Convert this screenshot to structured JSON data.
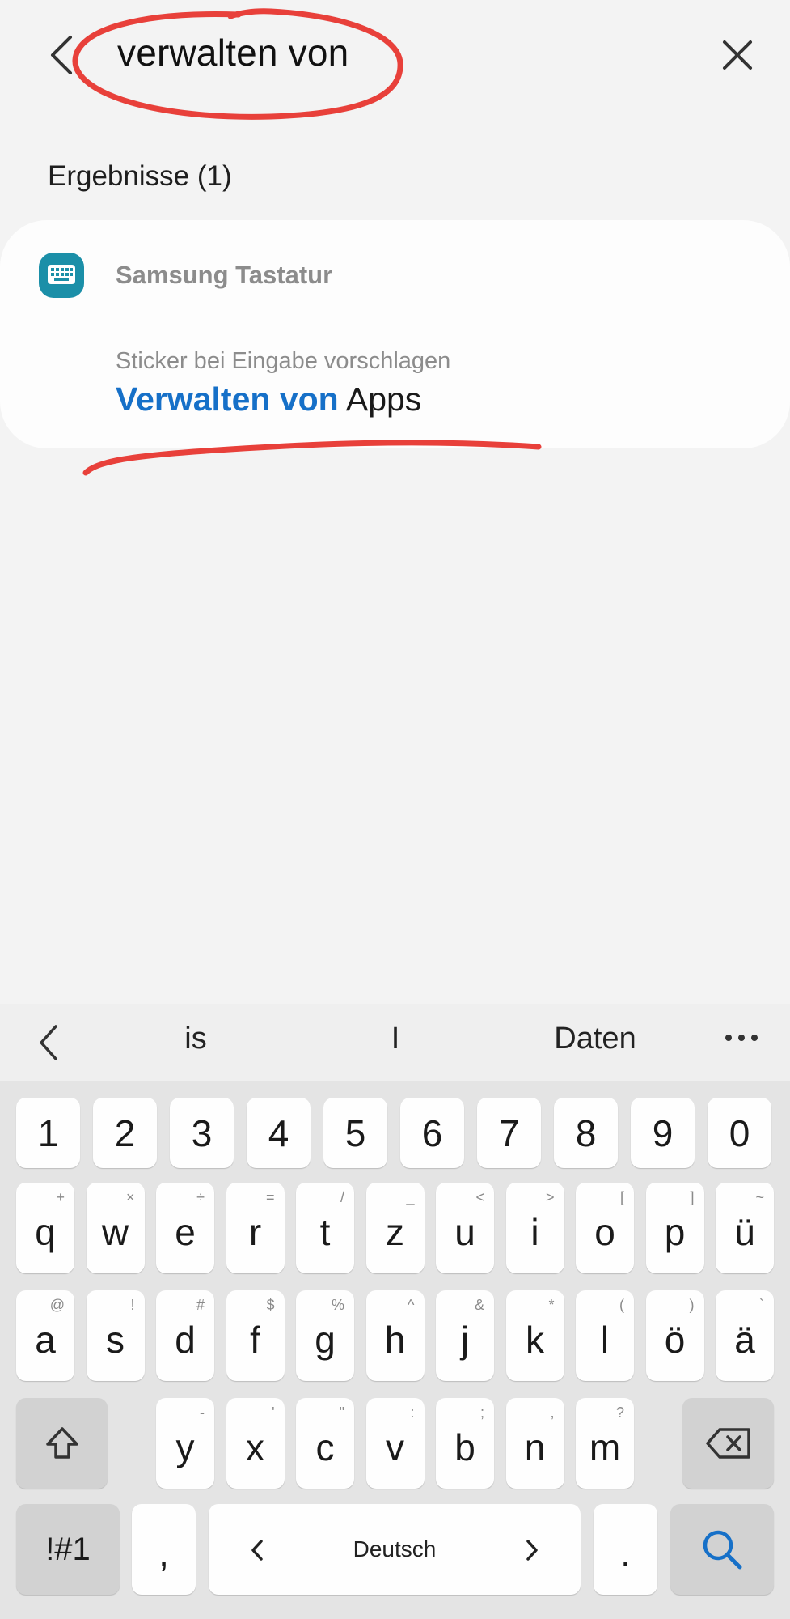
{
  "search": {
    "query": "verwalten von"
  },
  "results": {
    "header": "Ergebnisse (1)",
    "items": [
      {
        "app": "Samsung Tastatur",
        "subtitle": "Sticker bei Eingabe vorschlagen",
        "title_highlight": "Verwalten von",
        "title_rest": " Apps",
        "icon": "keyboard-icon"
      }
    ]
  },
  "keyboard": {
    "suggestions": [
      "is",
      "I",
      "Daten"
    ],
    "number_row": [
      "1",
      "2",
      "3",
      "4",
      "5",
      "6",
      "7",
      "8",
      "9",
      "0"
    ],
    "row1": [
      {
        "main": "q",
        "sec": "+"
      },
      {
        "main": "w",
        "sec": "×"
      },
      {
        "main": "e",
        "sec": "÷"
      },
      {
        "main": "r",
        "sec": "="
      },
      {
        "main": "t",
        "sec": "/"
      },
      {
        "main": "z",
        "sec": "_"
      },
      {
        "main": "u",
        "sec": "<"
      },
      {
        "main": "i",
        "sec": ">"
      },
      {
        "main": "o",
        "sec": "["
      },
      {
        "main": "p",
        "sec": "]"
      },
      {
        "main": "ü",
        "sec": "~"
      }
    ],
    "row2": [
      {
        "main": "a",
        "sec": "@"
      },
      {
        "main": "s",
        "sec": "!"
      },
      {
        "main": "d",
        "sec": "#"
      },
      {
        "main": "f",
        "sec": "$"
      },
      {
        "main": "g",
        "sec": "%"
      },
      {
        "main": "h",
        "sec": "^"
      },
      {
        "main": "j",
        "sec": "&"
      },
      {
        "main": "k",
        "sec": "*"
      },
      {
        "main": "l",
        "sec": "("
      },
      {
        "main": "ö",
        "sec": ")"
      },
      {
        "main": "ä",
        "sec": "`"
      }
    ],
    "row3": [
      {
        "main": "y",
        "sec": "-"
      },
      {
        "main": "x",
        "sec": "'"
      },
      {
        "main": "c",
        "sec": "\""
      },
      {
        "main": "v",
        "sec": ":"
      },
      {
        "main": "b",
        "sec": ";"
      },
      {
        "main": "n",
        "sec": ","
      },
      {
        "main": "m",
        "sec": "?"
      }
    ],
    "symbols_label": "!#1",
    "comma_label": ",",
    "space_label": "Deutsch",
    "period_label": ".",
    "accent_color": "#1670c8",
    "annotation_color": "#e8403a"
  }
}
